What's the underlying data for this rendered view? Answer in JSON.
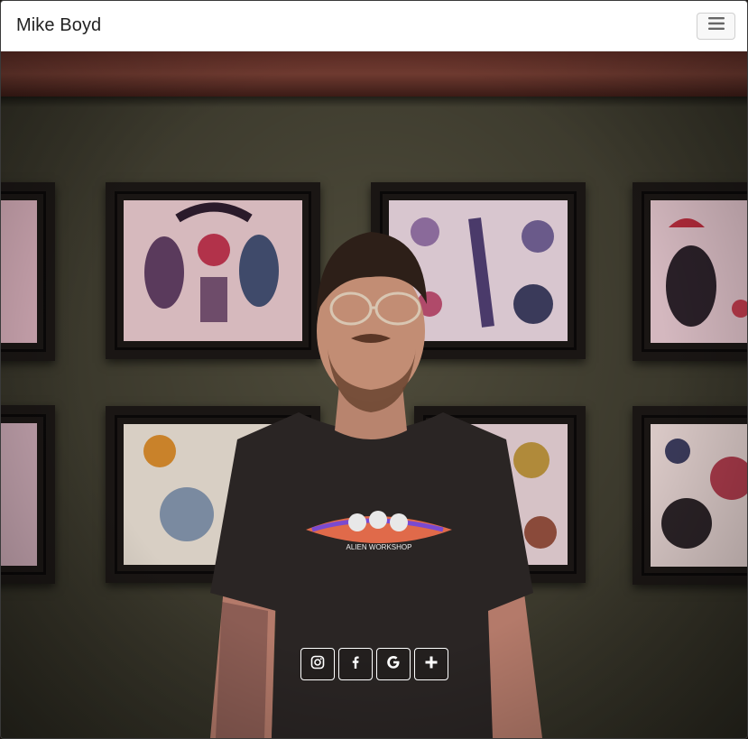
{
  "navbar": {
    "brand": "Mike Boyd",
    "toggler_icon": "hamburger-menu-icon"
  },
  "hero": {
    "photo_subject": "person-portrait",
    "shirt_logo_text": "ALIEN WORKSHOP"
  },
  "social": {
    "buttons": [
      {
        "icon": "instagram-icon"
      },
      {
        "icon": "facebook-icon"
      },
      {
        "icon": "google-icon"
      },
      {
        "icon": "plus-icon"
      }
    ]
  },
  "colors": {
    "navbar_bg": "#ffffff",
    "wall": "#4f4c3b",
    "beam": "#5b2b24",
    "button_border": "#ffffff"
  }
}
